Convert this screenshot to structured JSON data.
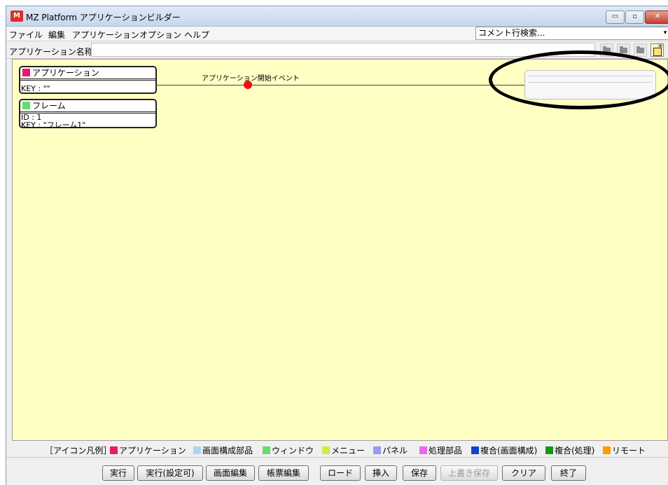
{
  "window": {
    "logo_text": "M",
    "title": "MZ Platform アプリケーションビルダー",
    "minimize_symbol": "▭",
    "restore_symbol": "▫",
    "close_symbol": "✕"
  },
  "menu": {
    "items": [
      {
        "label": "ファイル"
      },
      {
        "label": "編集"
      },
      {
        "label": "アプリケーション"
      },
      {
        "label": "オプション"
      },
      {
        "label": "ヘルプ"
      }
    ],
    "comment_search": {
      "value": "コメント行検索...",
      "arrow": "▾"
    }
  },
  "namebar": {
    "label": "アプリケーション名称",
    "value": ""
  },
  "toolbar": {
    "icons": [
      "open-folder-icon",
      "save-folder-icon",
      "folder-icon",
      "new-document-icon"
    ]
  },
  "canvas": {
    "nodes": [
      {
        "title": "アプリケーション",
        "lines": [
          "KEY : \"\""
        ],
        "color": "#e8196a"
      },
      {
        "title": "フレーム",
        "lines": [
          "ID : 1",
          "KEY : \"フレーム1\""
        ],
        "color": "#66dd66"
      }
    ],
    "event_label": "アプリケーション開始イベント",
    "event_color": "#ee1111",
    "highlight_color": "#000000"
  },
  "legend": {
    "heading": "［アイコン凡例］",
    "items": [
      {
        "label": "アプリケーション",
        "color": "#e8196a"
      },
      {
        "label": "画面構成部品",
        "color": "#a8d8ea"
      },
      {
        "label": "ウィンドウ",
        "color": "#66dd66"
      },
      {
        "label": "メニュー",
        "color": "#ccee44"
      },
      {
        "label": "パネル",
        "color": "#9999ee"
      },
      {
        "label": "処理部品",
        "color": "#ee66ee"
      },
      {
        "label": "複合(画面構成)",
        "color": "#1144cc"
      },
      {
        "label": "複合(処理)",
        "color": "#119911"
      },
      {
        "label": "リモート",
        "color": "#ff9900"
      }
    ]
  },
  "buttons": [
    {
      "label": "実行",
      "enabled": true
    },
    {
      "label": "実行(設定可)",
      "enabled": true
    },
    {
      "label": "画面編集",
      "enabled": true
    },
    {
      "label": "帳票編集",
      "enabled": true
    },
    {
      "label": "ロード",
      "enabled": true
    },
    {
      "label": "挿入",
      "enabled": true
    },
    {
      "label": "保存",
      "enabled": true
    },
    {
      "label": "上書き保存",
      "enabled": false
    },
    {
      "label": "クリア",
      "enabled": true
    },
    {
      "label": "終了",
      "enabled": true
    }
  ]
}
